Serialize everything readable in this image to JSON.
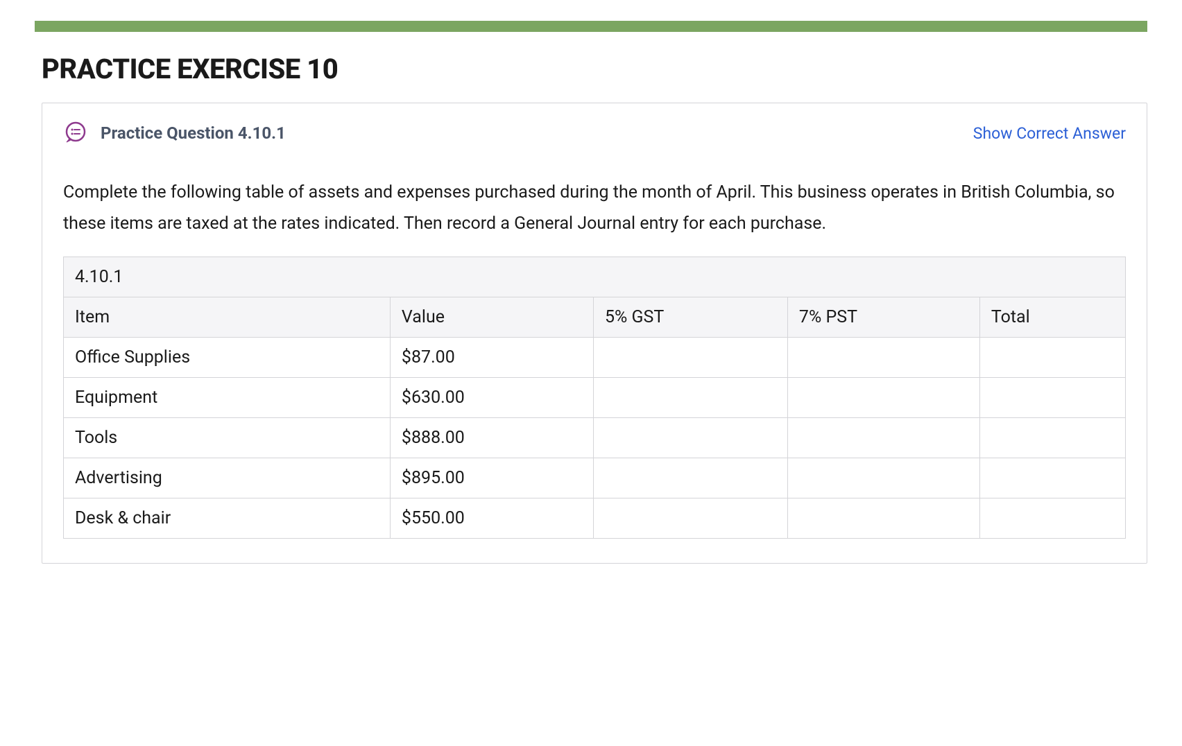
{
  "heading": "PRACTICE EXERCISE 10",
  "question": {
    "title": "Practice Question 4.10.1",
    "show_answer_label": "Show Correct Answer",
    "description": "Complete the following table of assets and expenses purchased during the month of April. This business operates in British Columbia, so these items are taxed at the rates indicated. Then record a General Journal entry for each purchase."
  },
  "table": {
    "number": "4.10.1",
    "columns": [
      "Item",
      "Value",
      "5% GST",
      "7% PST",
      "Total"
    ],
    "rows": [
      {
        "item": "Office Supplies",
        "value": "$87.00",
        "gst": "",
        "pst": "",
        "total": ""
      },
      {
        "item": "Equipment",
        "value": "$630.00",
        "gst": "",
        "pst": "",
        "total": ""
      },
      {
        "item": "Tools",
        "value": "$888.00",
        "gst": "",
        "pst": "",
        "total": ""
      },
      {
        "item": "Advertising",
        "value": "$895.00",
        "gst": "",
        "pst": "",
        "total": ""
      },
      {
        "item": "Desk & chair",
        "value": "$550.00",
        "gst": "",
        "pst": "",
        "total": ""
      }
    ]
  }
}
